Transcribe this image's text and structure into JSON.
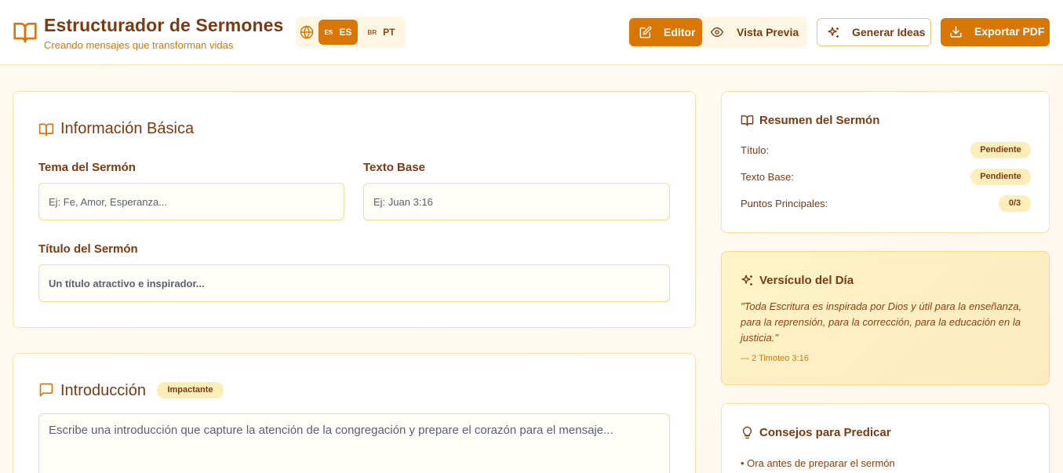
{
  "header": {
    "title": "Estructurador de Sermones",
    "subtitle": "Creando mensajes que transforman vidas",
    "language": {
      "options": [
        {
          "flag": "ES",
          "label": "ES",
          "active": true
        },
        {
          "flag": "BR",
          "label": "PT",
          "active": false
        }
      ]
    },
    "modes": {
      "editor": "Editor",
      "preview": "Vista Previa",
      "active": "Editor"
    },
    "ideas_label": "Generar Ideas",
    "export_label": "Exportar PDF"
  },
  "basic_info": {
    "title": "Información Básica",
    "theme_label": "Tema del Sermón",
    "theme_placeholder": "Ej: Fe, Amor, Esperanza...",
    "text_label": "Texto Base",
    "text_placeholder": "Ej: Juan 3:16",
    "sermon_title_label": "Título del Sermón",
    "sermon_title_placeholder": "Un título atractivo e inspirador..."
  },
  "introduction": {
    "title": "Introducción",
    "badge": "Impactante",
    "placeholder": "Escribe una introducción que capture la atención de la congregación y prepare el corazón para el mensaje..."
  },
  "summary": {
    "title": "Resumen del Sermón",
    "rows": [
      {
        "label": "Título:",
        "value": "Pendiente"
      },
      {
        "label": "Texto Base:",
        "value": "Pendiente"
      },
      {
        "label": "Puntos Principales:",
        "value": "0/3"
      }
    ]
  },
  "verse": {
    "title": "Versículo del Día",
    "text": "\"Toda Escritura es inspirada por Dios y útil para la enseñanza, para la reprensión, para la corrección, para la educación en la justicia.\"",
    "reference": "— 2 Timoteo 3:16"
  },
  "tips": {
    "title": "Consejos para Predicar",
    "items": [
      "• Ora antes de preparar el sermón"
    ]
  },
  "colors": {
    "accent": "#d97706",
    "text": "#7c3a12",
    "badge_bg": "#fdedb9",
    "border": "#f8e3a8"
  }
}
